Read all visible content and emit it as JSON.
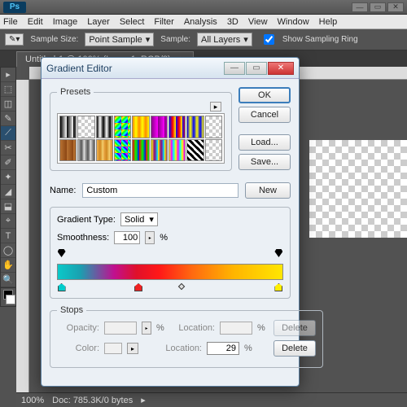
{
  "app": {
    "logo": "Ps"
  },
  "menu": [
    "File",
    "Edit",
    "Image",
    "Layer",
    "Select",
    "Filter",
    "Analysis",
    "3D",
    "View",
    "Window",
    "Help"
  ],
  "options": {
    "sample_size_label": "Sample Size:",
    "sample_size_value": "Point Sample",
    "sample_label": "Sample:",
    "sample_value": "All Layers",
    "show_ring": "Show Sampling Ring"
  },
  "doc_tab": "Untitled-1 @ 100% (Layer 1, RGB/8)",
  "status": {
    "zoom": "100%",
    "doc": "Doc: 785.3K/0 bytes"
  },
  "dialog": {
    "title": "Gradient Editor",
    "presets_label": "Presets",
    "ok": "OK",
    "cancel": "Cancel",
    "load": "Load...",
    "save": "Save...",
    "new": "New",
    "name_label": "Name:",
    "name_value": "Custom",
    "gtype_label": "Gradient Type:",
    "gtype_value": "Solid",
    "smooth_label": "Smoothness:",
    "smooth_value": "100",
    "stops_label": "Stops",
    "opacity_label": "Opacity:",
    "location_label": "Location:",
    "color_label": "Color:",
    "location_value": "29",
    "delete": "Delete"
  },
  "preset_gradients": [
    "linear-gradient(90deg,#000,#fff)",
    "repeating-conic-gradient(#ccc 0 25%,#fff 0 50%)",
    "linear-gradient(90deg,#000,#fff 50%,#000)",
    "linear-gradient(135deg,#f00,#ff0,#0f0,#0ff,#00f,#f0f)",
    "linear-gradient(90deg,#f80,#ff0,#f80)",
    "linear-gradient(90deg,#808,#f0f)",
    "linear-gradient(90deg,#00f,#f00,#ff0)",
    "linear-gradient(90deg,#00f,#ff0,#00f)",
    "repeating-conic-gradient(#ccc 0 25%,#fff 0 50%)",
    "linear-gradient(90deg,#b87333,#8b4513)",
    "linear-gradient(90deg,#c0c0c0,#545454,#f0f0f0)",
    "linear-gradient(90deg,#f0b050,#d08820,#f8d878)",
    "linear-gradient(45deg,#f00,#ff0,#0f0,#0ff,#00f,#f0f,#f00)",
    "linear-gradient(90deg,#f00,#0f0,#00f)",
    "linear-gradient(90deg,#ff0,#808,#0ff)",
    "linear-gradient(90deg,#ff0,#f0f,#0ff,#ff0)",
    "repeating-linear-gradient(45deg,#000 0 3px,#fff 3px 6px)",
    "repeating-conic-gradient(#ccc 0 25%,#fff 0 50%)"
  ],
  "tools": [
    "▸",
    "⬚",
    "◫",
    "✎",
    "⟋",
    "✂",
    "✐",
    "✦",
    "◢",
    "⬓",
    "⌖",
    "T",
    "◯",
    "✋",
    "🔍"
  ]
}
